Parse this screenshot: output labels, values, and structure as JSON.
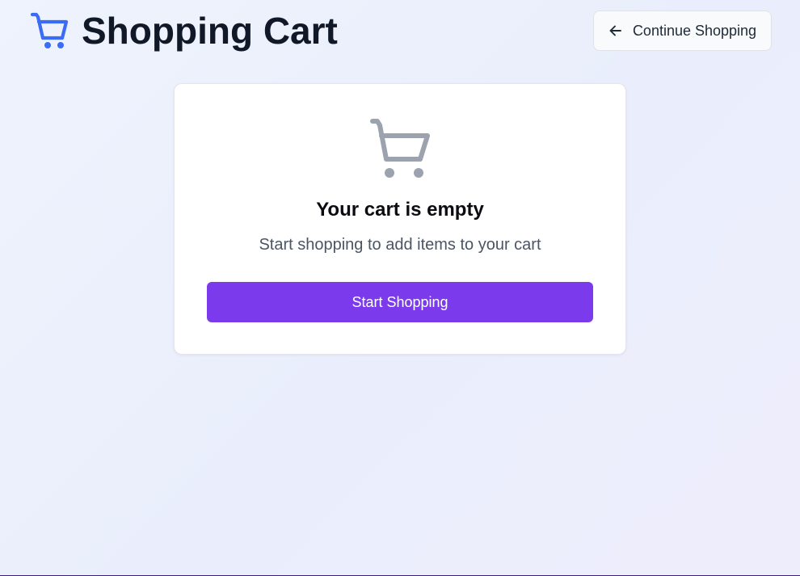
{
  "header": {
    "title": "Shopping Cart",
    "brand_icon": "shopping-cart-icon",
    "continue_button": {
      "label": "Continue Shopping",
      "icon": "arrow-left-icon"
    }
  },
  "empty_state": {
    "icon": "shopping-cart-icon",
    "title": "Your cart is empty",
    "subtitle": "Start shopping to add items to your cart",
    "button_label": "Start Shopping"
  },
  "colors": {
    "brand_icon": "#3b6cf6",
    "empty_icon": "#9ca3af",
    "primary_button": "#7c3aed",
    "title_text": "#111827"
  }
}
